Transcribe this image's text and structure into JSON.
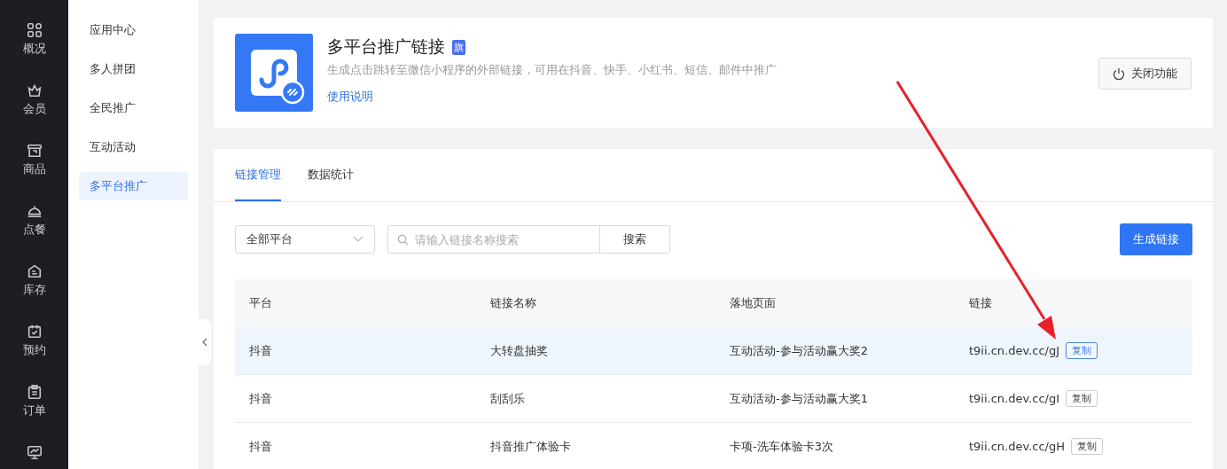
{
  "nav": [
    {
      "label": "概况",
      "selected": false
    },
    {
      "label": "会员",
      "selected": false
    },
    {
      "label": "商品",
      "selected": false
    },
    {
      "label": "点餐",
      "selected": false
    },
    {
      "label": "库存",
      "selected": false
    },
    {
      "label": "预约",
      "selected": false
    },
    {
      "label": "订单",
      "selected": false
    },
    {
      "selected": false
    }
  ],
  "submenu": [
    {
      "label": "应用中心",
      "selected": false
    },
    {
      "label": "多人拼团",
      "selected": false
    },
    {
      "label": "全民推广",
      "selected": false
    },
    {
      "label": "互动活动",
      "selected": false
    },
    {
      "label": "多平台推广",
      "selected": true
    }
  ],
  "header": {
    "title": "多平台推广链接",
    "badge": "旗",
    "description": "生成点击跳转至微信小程序的外部链接，可用在抖音、快手、小红书、短信、邮件中推广",
    "help_link": "使用说明",
    "close_button": "关闭功能"
  },
  "tabs": [
    {
      "label": "链接管理",
      "selected": true
    },
    {
      "label": "数据统计",
      "selected": false
    }
  ],
  "filter": {
    "platform": "全部平台",
    "search_placeholder": "请输入链接名称搜索",
    "search_button": "搜索",
    "create_button": "生成链接"
  },
  "table": {
    "columns": [
      "平台",
      "链接名称",
      "落地页面",
      "链接"
    ],
    "rows": [
      {
        "platform": "抖音",
        "name": "大转盘抽奖",
        "page": "互动活动-参与活动赢大奖2",
        "link": "t9ii.cn.dev.cc/gJ",
        "copy": "复制",
        "highlighted": true
      },
      {
        "platform": "抖音",
        "name": "刮刮乐",
        "page": "互动活动-参与活动赢大奖1",
        "link": "t9ii.cn.dev.cc/gI",
        "copy": "复制",
        "highlighted": false
      },
      {
        "platform": "抖音",
        "name": "抖音推广体验卡",
        "page": "卡项-洗车体验卡3次",
        "link": "t9ii.cn.dev.cc/gH",
        "copy": "复制",
        "highlighted": false
      }
    ]
  }
}
